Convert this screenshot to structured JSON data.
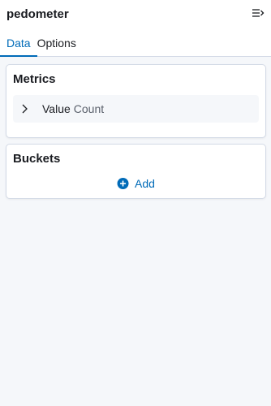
{
  "header": {
    "title": "pedometer",
    "collapse_icon": "collapse-icon"
  },
  "tabs": [
    {
      "label": "Data",
      "active": true
    },
    {
      "label": "Options",
      "active": false
    }
  ],
  "metrics": {
    "title": "Metrics",
    "items": [
      {
        "label": "Value",
        "type": "Count",
        "icon": "chevron-right-icon"
      }
    ]
  },
  "buckets": {
    "title": "Buckets",
    "add_label": "Add",
    "add_icon": "plus-circle-icon"
  },
  "colors": {
    "accent": "#006bb8",
    "background": "#f5f7fa",
    "panel_border": "#d3dae6"
  }
}
